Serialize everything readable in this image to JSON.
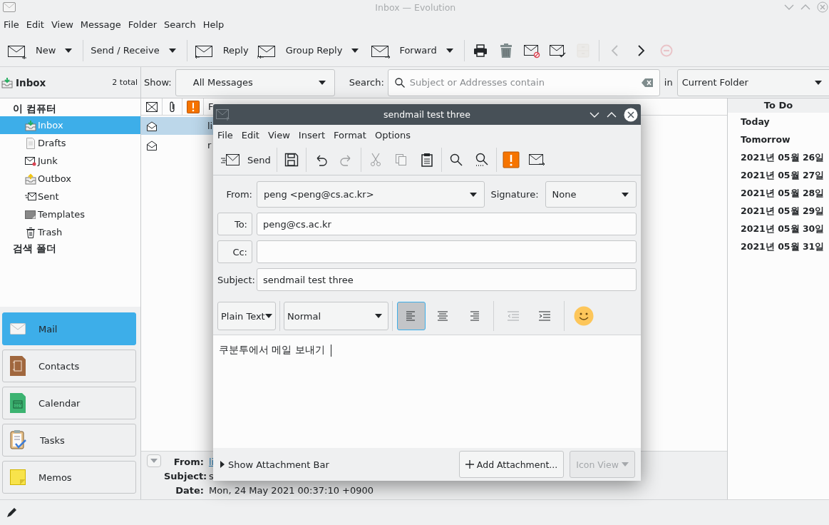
{
  "window": {
    "title": "Inbox — Evolution"
  },
  "menu": [
    "File",
    "Edit",
    "View",
    "Message",
    "Folder",
    "Search",
    "Help"
  ],
  "toolbar": [
    [
      {
        "kind": "labeled",
        "label": "New",
        "dropdown": true
      }
    ],
    [
      {
        "kind": "text",
        "label": "Send / Receive",
        "dropdown": true
      }
    ],
    [
      {
        "kind": "labeled",
        "label": "Reply"
      },
      {
        "kind": "labeled",
        "label": "Group Reply",
        "dropdown": true
      },
      {
        "kind": "labeled",
        "label": "Forward",
        "dropdown": true
      }
    ],
    [
      {
        "kind": "icon",
        "disabled": false
      },
      {
        "kind": "icon",
        "disabled": false
      },
      {
        "kind": "icon",
        "disabled": false
      },
      {
        "kind": "icon",
        "disabled": false
      },
      {
        "kind": "icon",
        "disabled": true
      }
    ],
    [
      {
        "kind": "icon",
        "disabled": true
      },
      {
        "kind": "icon",
        "disabled": false
      },
      {
        "kind": "icon",
        "disabled": true
      }
    ]
  ],
  "folder_header": {
    "title": "Inbox",
    "count": "2 total"
  },
  "filter": {
    "show_label": "Show:",
    "show_value": "All Messages",
    "search_label": "Search:",
    "search_placeholder": "Subject or Addresses contain",
    "in_label": "in",
    "scope": "Current Folder"
  },
  "folders": [
    {
      "label": "이 컴퓨터",
      "children": [
        {
          "label": "Inbox",
          "selected": true
        },
        {
          "label": "Drafts",
          "selected": false
        },
        {
          "label": "Junk",
          "selected": false
        },
        {
          "label": "Outbox",
          "selected": false
        },
        {
          "label": "Sent",
          "selected": false
        },
        {
          "label": "Templates",
          "selected": false
        },
        {
          "label": "Trash",
          "selected": false
        }
      ]
    },
    {
      "label": "검색 폴더"
    }
  ],
  "switcher": [
    {
      "label": "Mail",
      "selected": true
    },
    {
      "label": "Contacts",
      "selected": false
    },
    {
      "label": "Calendar",
      "selected": false
    },
    {
      "label": "Tasks",
      "selected": false
    },
    {
      "label": "Memos",
      "selected": false
    }
  ],
  "message_list": {
    "column_4": "F",
    "rows": [
      {
        "column_4": "li",
        "selected": true
      },
      {
        "column_4": "r",
        "selected": false
      }
    ]
  },
  "preview": [
    {
      "label": "From:",
      "value": "li",
      "kind": "link"
    },
    {
      "label": "Subject:",
      "value": "s",
      "kind": "text"
    },
    {
      "label": "Date:",
      "value": "Mon, 24 May 2021 00:37:10 +0900",
      "kind": "text"
    }
  ],
  "todo": {
    "title": "To Do",
    "items": [
      "Today",
      "Tomorrow",
      "2021년 05월 26일",
      "2021년 05월 27일",
      "2021년 05월 28일",
      "2021년 05월 29일",
      "2021년 05월 30일",
      "2021년 05월 31일"
    ]
  },
  "compose": {
    "title": "sendmail test three",
    "menu": [
      "File",
      "Edit",
      "View",
      "Insert",
      "Format",
      "Options"
    ],
    "toolbar": [
      [
        {
          "kind": "labeled",
          "label": "Send"
        }
      ],
      [
        {
          "kind": "icon",
          "disabled": false
        }
      ],
      [
        {
          "kind": "icon",
          "disabled": false
        },
        {
          "kind": "icon",
          "disabled": true
        }
      ],
      [
        {
          "kind": "icon",
          "disabled": true
        },
        {
          "kind": "icon",
          "disabled": true
        },
        {
          "kind": "icon",
          "disabled": false
        }
      ],
      [
        {
          "kind": "icon",
          "disabled": false
        },
        {
          "kind": "icon",
          "disabled": false
        }
      ],
      [
        {
          "kind": "icon",
          "disabled": false
        },
        {
          "kind": "icon",
          "disabled": false
        }
      ]
    ],
    "from_label": "From:",
    "from": "peng <peng@cs.ac.kr>",
    "signature_label": "Signature:",
    "signature": "None",
    "to_label": "To:",
    "to": "peng@cs.ac.kr",
    "cc_label": "Cc:",
    "subject_label": "Subject:",
    "subject": "sendmail test three",
    "mode": "Plain Text",
    "paragraph": "Normal",
    "align": [
      {
        "selected": true
      },
      {
        "selected": false
      },
      {
        "selected": false
      }
    ],
    "indent": [
      {
        "disabled": true
      },
      {
        "disabled": false
      }
    ],
    "body": "쿠분투에서 메일 보내기",
    "attachment_bar": "Show Attachment Bar",
    "add_attachment": "Add Attachment...",
    "view": {
      "label": "Icon View",
      "disabled": true
    }
  }
}
